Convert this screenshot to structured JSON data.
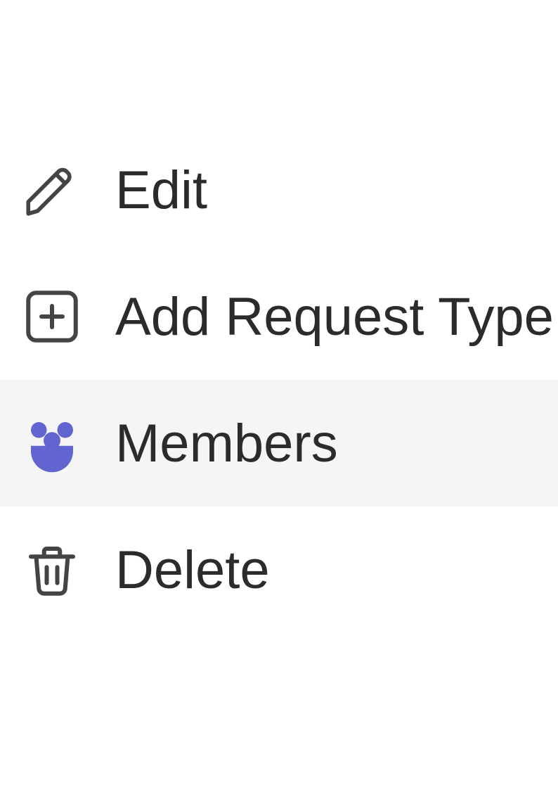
{
  "menu": {
    "items": [
      {
        "label": "Edit",
        "icon": "pencil-icon",
        "hover": false
      },
      {
        "label": "Add Request Type",
        "icon": "plus-square-icon",
        "hover": false
      },
      {
        "label": "Members",
        "icon": "members-icon",
        "hover": true
      },
      {
        "label": "Delete",
        "icon": "trash-icon",
        "hover": false
      }
    ]
  },
  "colors": {
    "icon_stroke": "#444444",
    "members_fill": "#6264d0",
    "hover_bg": "#f5f5f5"
  }
}
